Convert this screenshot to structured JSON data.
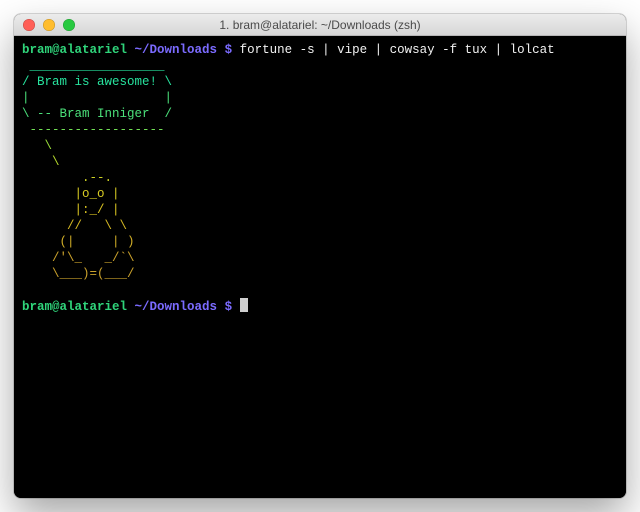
{
  "window": {
    "title": "1. bram@alatariel: ~/Downloads (zsh)"
  },
  "prompt": {
    "userhost": "bram@alatariel",
    "path": "~/Downloads",
    "sigil": "$"
  },
  "command": "fortune -s | vipe | cowsay -f tux | lolcat",
  "output": {
    "l01": " __________________",
    "l02": "/ Bram is awesome! \\",
    "l03": "|                  |",
    "l04": "\\ -- Bram Inniger  /",
    "l05": " ------------------",
    "l06": "   \\",
    "l07": "    \\",
    "l08": "        .--.",
    "l09": "       |o_o |",
    "l10": "       |:_/ |",
    "l11": "      //   \\ \\",
    "l12": "     (|     | )",
    "l13": "    /'\\_   _/`\\",
    "l14": "    \\___)=(___/"
  }
}
